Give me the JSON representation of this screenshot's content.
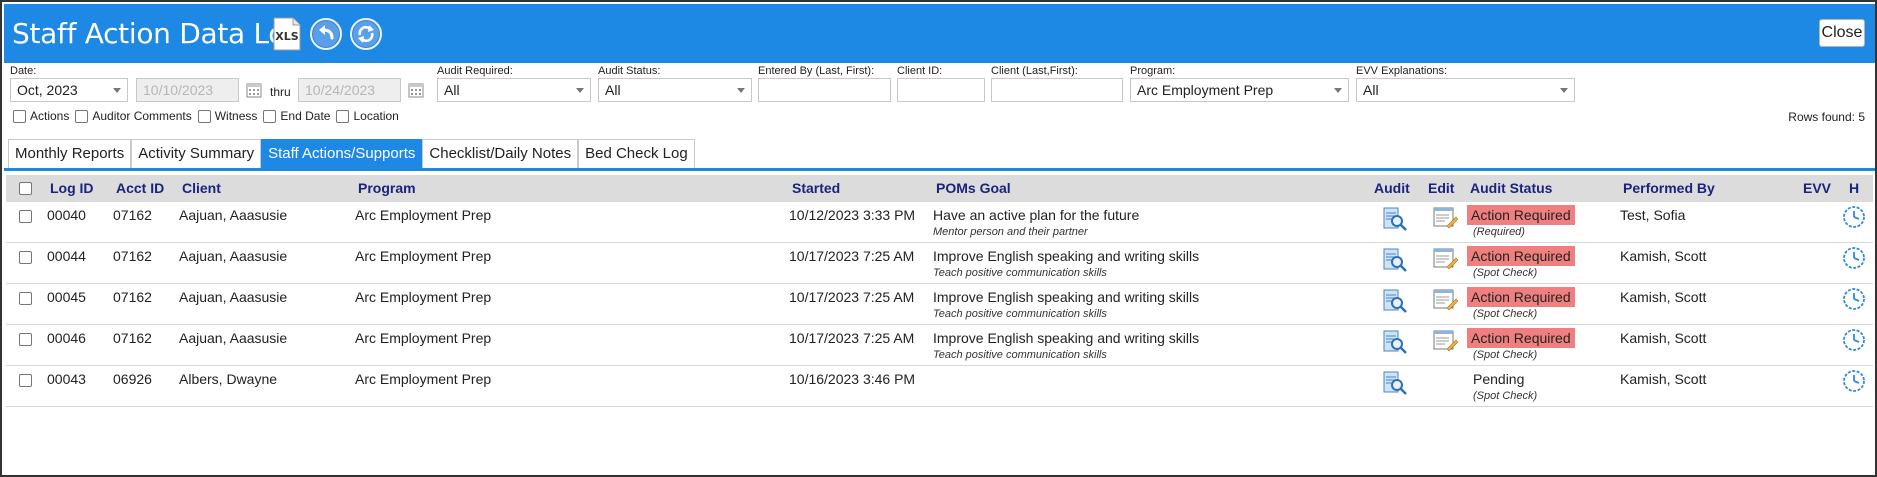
{
  "header": {
    "title": "Staff Action Data Log",
    "xls_icon_text": "XLS",
    "close_label": "Close",
    "icons": [
      "xls-export-icon",
      "undo-icon",
      "refresh-icon"
    ]
  },
  "filters": {
    "date_label": "Date:",
    "date_value": "Oct, 2023",
    "from_date": "10/10/2023",
    "thru_label": "thru",
    "to_date": "10/24/2023",
    "audit_required_label": "Audit Required:",
    "audit_required_value": "All",
    "audit_status_label": "Audit Status:",
    "audit_status_value": "All",
    "entered_by_label": "Entered By (Last, First):",
    "entered_by_value": "",
    "client_id_label": "Client ID:",
    "client_id_value": "",
    "client_name_label": "Client (Last,First):",
    "client_name_value": "",
    "program_label": "Program:",
    "program_value": "Arc Employment Prep",
    "evv_label": "EVV Explanations:",
    "evv_value": "All",
    "checkboxes": [
      "Actions",
      "Auditor Comments",
      "Witness",
      "End Date",
      "Location"
    ],
    "rows_found": "Rows found: 5"
  },
  "tabs": [
    {
      "label": "Monthly Reports",
      "active": false
    },
    {
      "label": "Activity Summary",
      "active": false
    },
    {
      "label": "Staff Actions/Supports",
      "active": true
    },
    {
      "label": "Checklist/Daily Notes",
      "active": false
    },
    {
      "label": "Bed Check Log",
      "active": false
    }
  ],
  "table": {
    "columns": [
      "Log ID",
      "Acct ID",
      "Client",
      "Program",
      "Started",
      "POMs Goal",
      "Audit",
      "Edit",
      "Audit Status",
      "Performed By",
      "EVV",
      "H"
    ],
    "rows": [
      {
        "log_id": "00040",
        "acct_id": "07162",
        "client": "Aajuan, Aaasusie",
        "program": "Arc Employment Prep",
        "started": "10/12/2023 3:33 PM",
        "goal": "Have an active plan for the future",
        "goal_sub": "Mentor person and their partner",
        "status": "Action Required",
        "status_sub": "(Required)",
        "performed_by": "Test, Sofia",
        "has_edit": true
      },
      {
        "log_id": "00044",
        "acct_id": "07162",
        "client": "Aajuan, Aaasusie",
        "program": "Arc Employment Prep",
        "started": "10/17/2023 7:25 AM",
        "goal": "Improve English speaking and writing skills",
        "goal_sub": "Teach positive communication skills",
        "status": "Action Required",
        "status_sub": "(Spot Check)",
        "performed_by": "Kamish, Scott",
        "has_edit": true
      },
      {
        "log_id": "00045",
        "acct_id": "07162",
        "client": "Aajuan, Aaasusie",
        "program": "Arc Employment Prep",
        "started": "10/17/2023 7:25 AM",
        "goal": "Improve English speaking and writing skills",
        "goal_sub": "Teach positive communication skills",
        "status": "Action Required",
        "status_sub": "(Spot Check)",
        "performed_by": "Kamish, Scott",
        "has_edit": true
      },
      {
        "log_id": "00046",
        "acct_id": "07162",
        "client": "Aajuan, Aaasusie",
        "program": "Arc Employment Prep",
        "started": "10/17/2023 7:25 AM",
        "goal": "Improve English speaking and writing skills",
        "goal_sub": "Teach positive communication skills",
        "status": "Action Required",
        "status_sub": "(Spot Check)",
        "performed_by": "Kamish, Scott",
        "has_edit": true
      },
      {
        "log_id": "00043",
        "acct_id": "06926",
        "client": "Albers, Dwayne",
        "program": "Arc Employment Prep",
        "started": "10/16/2023 3:46 PM",
        "goal": "",
        "goal_sub": "",
        "status": "Pending",
        "status_sub": "(Spot Check)",
        "performed_by": "Kamish, Scott",
        "has_edit": false
      }
    ]
  },
  "colors": {
    "accent": "#1e88e5",
    "header_text": "#1a237e",
    "action_required": "#f08080"
  }
}
